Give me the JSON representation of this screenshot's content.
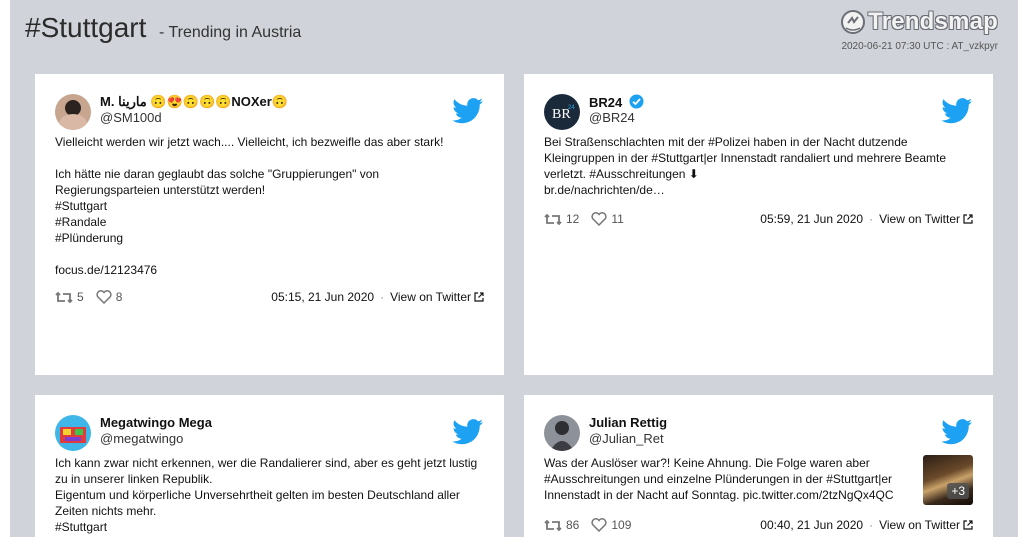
{
  "header": {
    "hashtag": "#Stuttgart",
    "subtitle": "- Trending in Austria",
    "logo_text": "Trendsmap",
    "timestamp": "2020-06-21 07:30 UTC : AT_vzkpyr"
  },
  "colors": {
    "twitter_blue": "#1da1f2",
    "background": "#d0d3d9"
  },
  "tweets": [
    {
      "name": "M. مارينا 🙃😍🙃🙃🙃NOXer🙃",
      "handle": "@SM100d",
      "lines": [
        "Vielleicht werden wir jetzt wach.... Vielleicht, ich bezweifle das aber stark!",
        "",
        "Ich hätte nie daran geglaubt das solche \"Gruppierungen\" von",
        "Regierungsparteien unterstützt werden!",
        "#Stuttgart",
        "#Randale",
        "#Plünderung",
        "",
        "focus.de/12123476"
      ],
      "retweets": "5",
      "likes": "8",
      "date": "05:15, 21 Jun 2020",
      "view_label": "View on Twitter"
    },
    {
      "name": "BR24",
      "handle": "@BR24",
      "verified": true,
      "lines": [
        "Bei Straßenschlachten mit der #Polizei haben in der Nacht dutzende",
        "Kleingruppen in der #Stuttgart|er Innenstadt randaliert und mehrere Beamte",
        "verletzt. #Ausschreitungen ⬇",
        "br.de/nachrichten/de…"
      ],
      "retweets": "12",
      "likes": "11",
      "date": "05:59, 21 Jun 2020",
      "view_label": "View on Twitter"
    },
    {
      "name": "Megatwingo Mega",
      "handle": "@megatwingo",
      "lines": [
        "Ich kann zwar nicht erkennen, wer die Randalierer sind, aber es geht jetzt lustig",
        "zu in unserer linken Republik.",
        "Eigentum und körperliche Unversehrtheit gelten im besten Deutschland aller",
        "Zeiten nichts mehr.",
        "#Stuttgart"
      ]
    },
    {
      "name": "Julian Rettig",
      "handle": "@Julian_Ret",
      "lines": [
        "Was der Auslöser war?! Keine Ahnung. Die Folge waren aber",
        "#Ausschreitungen und einzelne Plünderungen in der #Stuttgart|er",
        "Innenstadt in der Nacht auf Sonntag. pic.twitter.com/2tzNgQx4QC"
      ],
      "media_count": "+3",
      "retweets": "86",
      "likes": "109",
      "date": "00:40, 21 Jun 2020",
      "view_label": "View on Twitter"
    }
  ]
}
